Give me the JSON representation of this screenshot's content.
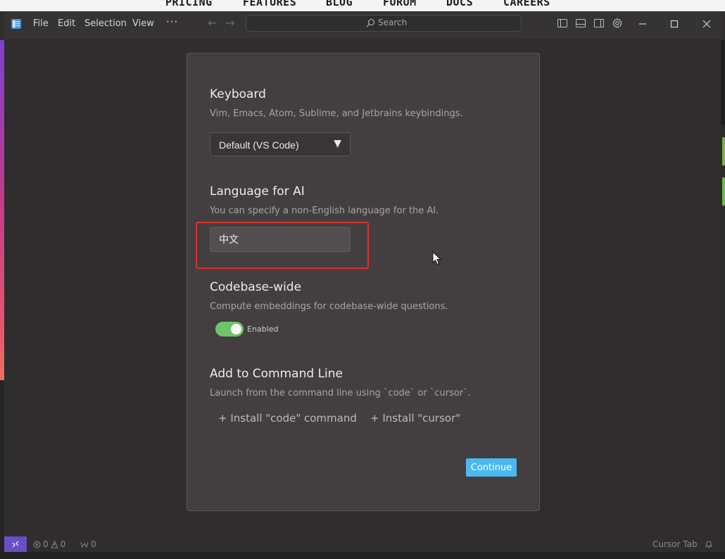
{
  "website_nav": [
    "PRICING",
    "FEATURES",
    "BLOG",
    "FORUM",
    "DOCS",
    "CAREERS"
  ],
  "titlebar": {
    "menu": [
      "File",
      "Edit",
      "Selection",
      "View"
    ],
    "more": "···",
    "search_placeholder": "Search",
    "icons": [
      "toggle-primary-sidebar-icon",
      "toggle-panel-icon",
      "toggle-secondary-sidebar-icon",
      "gear-icon"
    ],
    "window_controls": [
      "minimize",
      "maximize",
      "close"
    ]
  },
  "dialog": {
    "keyboard": {
      "title": "Keyboard",
      "description": "Vim, Emacs, Atom, Sublime, and Jetbrains keybindings.",
      "selected": "Default (VS Code)",
      "caret": "▼"
    },
    "language": {
      "title": "Language for AI",
      "description": "You can specify a non-English language for the AI.",
      "value": "中文"
    },
    "codebase": {
      "title": "Codebase-wide",
      "description": "Compute embeddings for codebase-wide questions.",
      "toggle_label": "Enabled",
      "enabled": true
    },
    "command_line": {
      "title": "Add to Command Line",
      "description": "Launch from the command line using `code` or `cursor`.",
      "install_code": "+ Install \"code\" command",
      "install_cursor": "+ Install \"cursor\""
    },
    "continue_label": "Continue"
  },
  "statusbar": {
    "errors": "0",
    "warnings": "0",
    "ports": "0",
    "right_label": "Cursor Tab"
  },
  "colors": {
    "accent_button": "#4bb9ef",
    "toggle_on": "#6ec46b",
    "highlight_box": "#e03030",
    "remote_indicator": "#6a4fc4"
  }
}
